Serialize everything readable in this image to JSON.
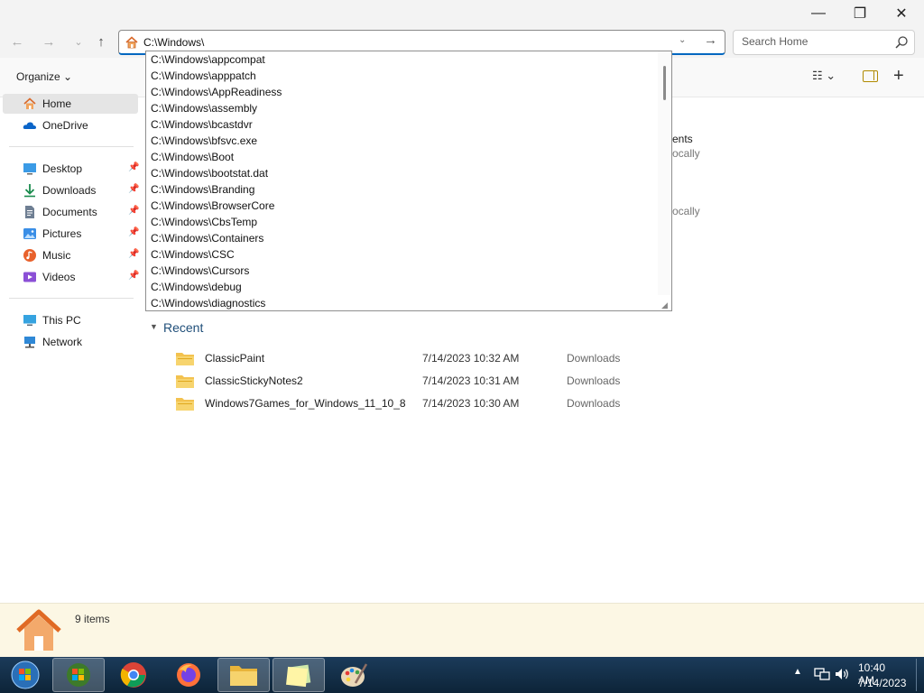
{
  "window_controls": {
    "minimize": "—",
    "maximize": "❐",
    "close": "✕"
  },
  "nav": {
    "back": "←",
    "forward": "→",
    "recent": "⌄",
    "up": "↑"
  },
  "address": {
    "value": "C:\\Windows\\",
    "go": "→",
    "dropdown": "⌄"
  },
  "search": {
    "placeholder": "Search Home"
  },
  "commandbar": {
    "organize": "Organize ⌄",
    "view": "☷ ⌄",
    "new_tab": "+"
  },
  "sidebar": {
    "items": [
      {
        "label": "Home",
        "icon": "home-icon"
      },
      {
        "label": "OneDrive",
        "icon": "cloud-icon"
      },
      {
        "label": "Desktop",
        "icon": "desktop-icon",
        "pinned": true
      },
      {
        "label": "Downloads",
        "icon": "download-icon",
        "pinned": true
      },
      {
        "label": "Documents",
        "icon": "documents-icon",
        "pinned": true
      },
      {
        "label": "Pictures",
        "icon": "pictures-icon",
        "pinned": true
      },
      {
        "label": "Music",
        "icon": "music-icon",
        "pinned": true
      },
      {
        "label": "Videos",
        "icon": "videos-icon",
        "pinned": true
      },
      {
        "label": "This PC",
        "icon": "computer-icon"
      },
      {
        "label": "Network",
        "icon": "network-icon"
      }
    ],
    "pin_glyph": "📌"
  },
  "behind": {
    "text1": "ents",
    "sub1": "ocally",
    "sub2": "ocally"
  },
  "recent": {
    "header": "Recent",
    "items": [
      {
        "name": "ClassicPaint",
        "date": "7/14/2023 10:32 AM",
        "location": "Downloads"
      },
      {
        "name": "ClassicStickyNotes2",
        "date": "7/14/2023 10:31 AM",
        "location": "Downloads"
      },
      {
        "name": "Windows7Games_for_Windows_11_10_8",
        "date": "7/14/2023 10:30 AM",
        "location": "Downloads"
      }
    ]
  },
  "autocomplete": {
    "items": [
      "C:\\Windows\\appcompat",
      "C:\\Windows\\apppatch",
      "C:\\Windows\\AppReadiness",
      "C:\\Windows\\assembly",
      "C:\\Windows\\bcastdvr",
      "C:\\Windows\\bfsvc.exe",
      "C:\\Windows\\Boot",
      "C:\\Windows\\bootstat.dat",
      "C:\\Windows\\Branding",
      "C:\\Windows\\BrowserCore",
      "C:\\Windows\\CbsTemp",
      "C:\\Windows\\Containers",
      "C:\\Windows\\CSC",
      "C:\\Windows\\Cursors",
      "C:\\Windows\\debug",
      "C:\\Windows\\diagnostics"
    ]
  },
  "status": {
    "count": "9 items"
  },
  "taskbar": {
    "apps": [
      "start",
      "windows-flag",
      "chrome",
      "firefox",
      "file-explorer",
      "sticky-notes",
      "paint"
    ],
    "time": "10:40 AM",
    "date": "7/14/2023",
    "tray_chevron": "▲"
  },
  "colors": {
    "accent": "#0067c0",
    "taskbar": "#12304a",
    "status_bg": "#fcf7e4",
    "folder": "#f3c24f"
  }
}
